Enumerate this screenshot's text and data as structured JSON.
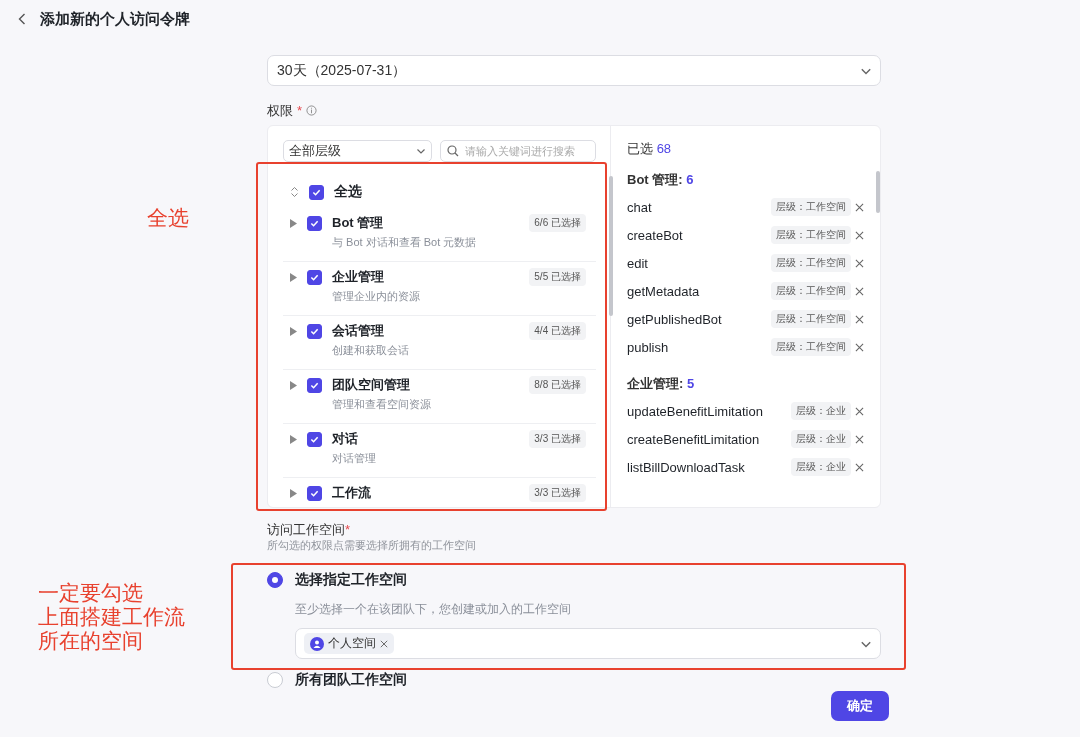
{
  "header": {
    "title": "添加新的个人访问令牌"
  },
  "expiry": {
    "value": "30天（2025-07-31）"
  },
  "permissions": {
    "label": "权限",
    "required_mark": "*",
    "level_filter": {
      "value": "全部层级"
    },
    "search": {
      "placeholder": "请输入关键词进行搜索"
    },
    "select_all": {
      "label": "全选",
      "checked": true
    },
    "groups": [
      {
        "name": "Bot 管理",
        "desc": "与 Bot 对话和查看 Bot 元数据",
        "count": "6/6 已选择",
        "checked": true,
        "expanded": false
      },
      {
        "name": "企业管理",
        "desc": "管理企业内的资源",
        "count": "5/5 已选择",
        "checked": true,
        "expanded": false
      },
      {
        "name": "会话管理",
        "desc": "创建和获取会话",
        "count": "4/4 已选择",
        "checked": true,
        "expanded": false
      },
      {
        "name": "团队空间管理",
        "desc": "管理和查看空间资源",
        "count": "8/8 已选择",
        "checked": true,
        "expanded": false
      },
      {
        "name": "对话",
        "desc": "对话管理",
        "count": "3/3 已选择",
        "checked": true,
        "expanded": false
      },
      {
        "name": "工作流",
        "count": "3/3 已选择",
        "checked": true,
        "expanded": false
      }
    ],
    "selected": {
      "label": "已选",
      "count": "68",
      "groups": [
        {
          "name": "Bot 管理:",
          "count": "6",
          "items": [
            {
              "name": "chat",
              "level": "层级：工作空间"
            },
            {
              "name": "createBot",
              "level": "层级：工作空间"
            },
            {
              "name": "edit",
              "level": "层级：工作空间"
            },
            {
              "name": "getMetadata",
              "level": "层级：工作空间"
            },
            {
              "name": "getPublishedBot",
              "level": "层级：工作空间"
            },
            {
              "name": "publish",
              "level": "层级：工作空间"
            }
          ]
        },
        {
          "name": "企业管理:",
          "count": "5",
          "items": [
            {
              "name": "updateBenefitLimitation",
              "level": "层级：企业"
            },
            {
              "name": "createBenefitLimitation",
              "level": "层级：企业"
            },
            {
              "name": "listBillDownloadTask",
              "level": "层级：企业"
            }
          ]
        }
      ]
    }
  },
  "workspace": {
    "label": "访问工作空间",
    "required_mark": "*",
    "hint": "所勾选的权限点需要选择所拥有的工作空间",
    "options": [
      {
        "label": "选择指定工作空间",
        "selected": true,
        "desc": "至少选择一个在该团队下，您创建或加入的工作空间",
        "tags": [
          "个人空间"
        ]
      },
      {
        "label": "所有团队工作空间",
        "selected": false
      }
    ]
  },
  "confirm": "确定",
  "annotations": [
    {
      "lines": [
        "全选"
      ]
    },
    {
      "lines": [
        "一定要勾选",
        "上面搭建工作流",
        "所在的空间"
      ]
    }
  ]
}
